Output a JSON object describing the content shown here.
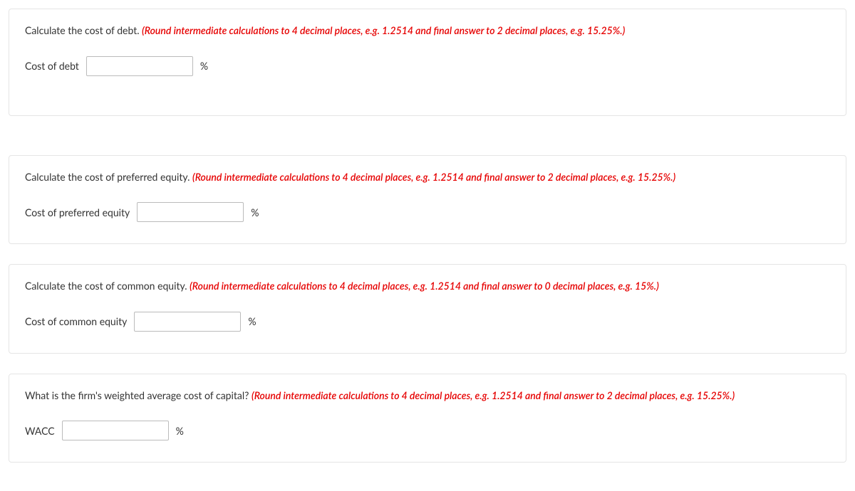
{
  "questions": [
    {
      "prompt_black": "Calculate the cost of debt. ",
      "prompt_red": "(Round intermediate calculations to 4 decimal places, e.g. 1.2514 and final answer to 2 decimal places, e.g. 15.25%.)",
      "label": "Cost of debt",
      "value": "",
      "unit": "%"
    },
    {
      "prompt_black": "Calculate the cost of preferred equity. ",
      "prompt_red": "(Round intermediate calculations to 4 decimal places, e.g. 1.2514 and final answer to 2 decimal places, e.g. 15.25%.)",
      "label": "Cost of preferred equity",
      "value": "",
      "unit": "%"
    },
    {
      "prompt_black": "Calculate the cost of common equity. ",
      "prompt_red": "(Round intermediate calculations to 4 decimal places, e.g. 1.2514 and final answer to 0 decimal places, e.g. 15%.)",
      "label": "Cost of common equity",
      "value": "",
      "unit": "%"
    },
    {
      "prompt_black": "What is the firm's weighted average cost of capital? ",
      "prompt_red": "(Round intermediate calculations to 4 decimal places, e.g. 1.2514 and final answer to 2 decimal places, e.g. 15.25%.)",
      "label": "WACC",
      "value": "",
      "unit": "%"
    }
  ]
}
